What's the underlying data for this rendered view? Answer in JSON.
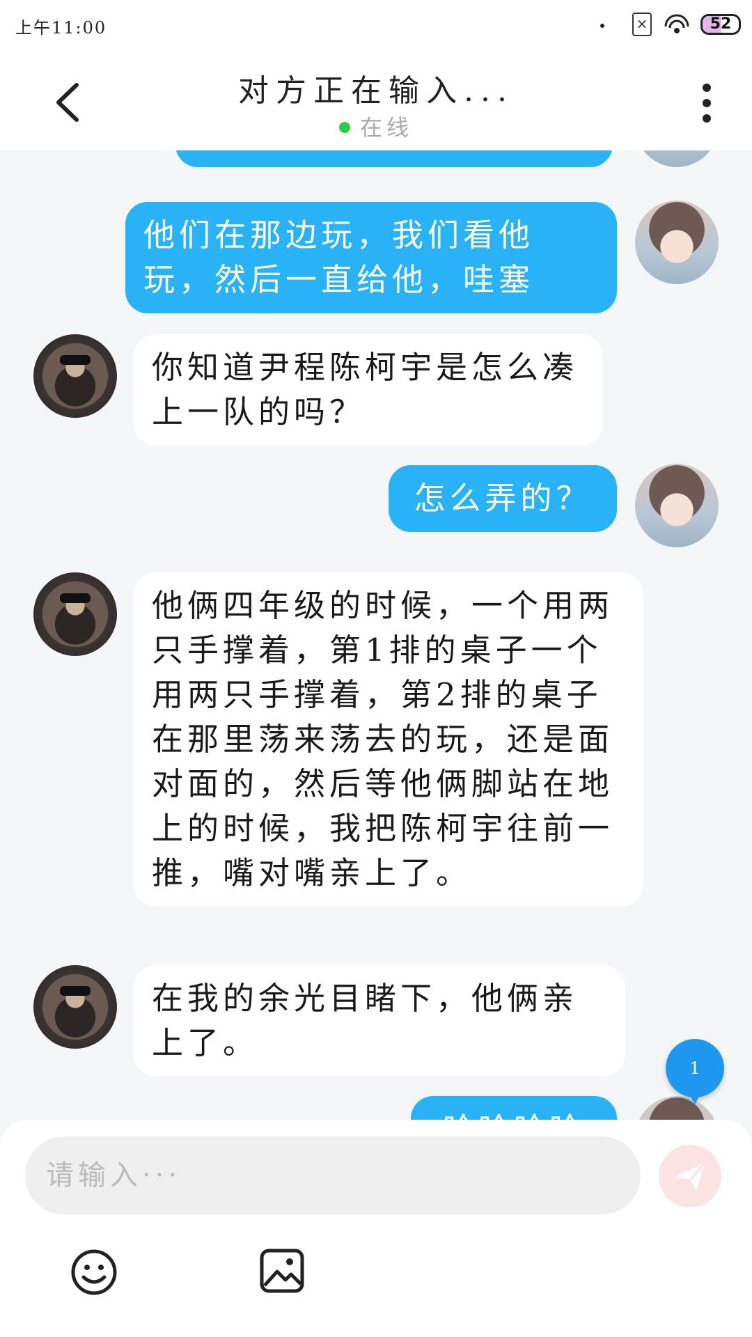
{
  "status_bar": {
    "time": "上午11:00",
    "battery": "52",
    "battery_level": 0.52
  },
  "header": {
    "title": "对方正在输入...",
    "status": "在线"
  },
  "messages": [
    {
      "side": "out",
      "text": "他们在那边玩，我们看他玩，然后一直给他，哇塞"
    },
    {
      "side": "in",
      "text": "你知道尹程陈柯宇是怎么凑上一队的吗？"
    },
    {
      "side": "out",
      "text": "怎么弄的？"
    },
    {
      "side": "in",
      "text": "他俩四年级的时候，一个用两只手撑着，第1排的桌子一个用两只手撑着，第2排的桌子在那里荡来荡去的玩，还是面对面的，然后等他俩脚站在地上的时候，我把陈柯宇往前一推，嘴对嘴亲上了。"
    },
    {
      "side": "in",
      "text": "在我的余光目睹下，他俩亲上了。"
    },
    {
      "side": "out",
      "text": "哈哈哈哈"
    }
  ],
  "scroll_badge": {
    "count": "1"
  },
  "composer": {
    "placeholder": "请输入···"
  },
  "icons": {
    "back": "back-arrow-icon",
    "more": "more-vertical-icon",
    "send": "send-icon",
    "emoji": "emoji-icon",
    "image": "image-icon"
  },
  "colors": {
    "outgoing_bubble": "#29b2f5",
    "incoming_bubble": "#ffffff",
    "online": "#2ecc40",
    "badge": "#1e97ef"
  }
}
